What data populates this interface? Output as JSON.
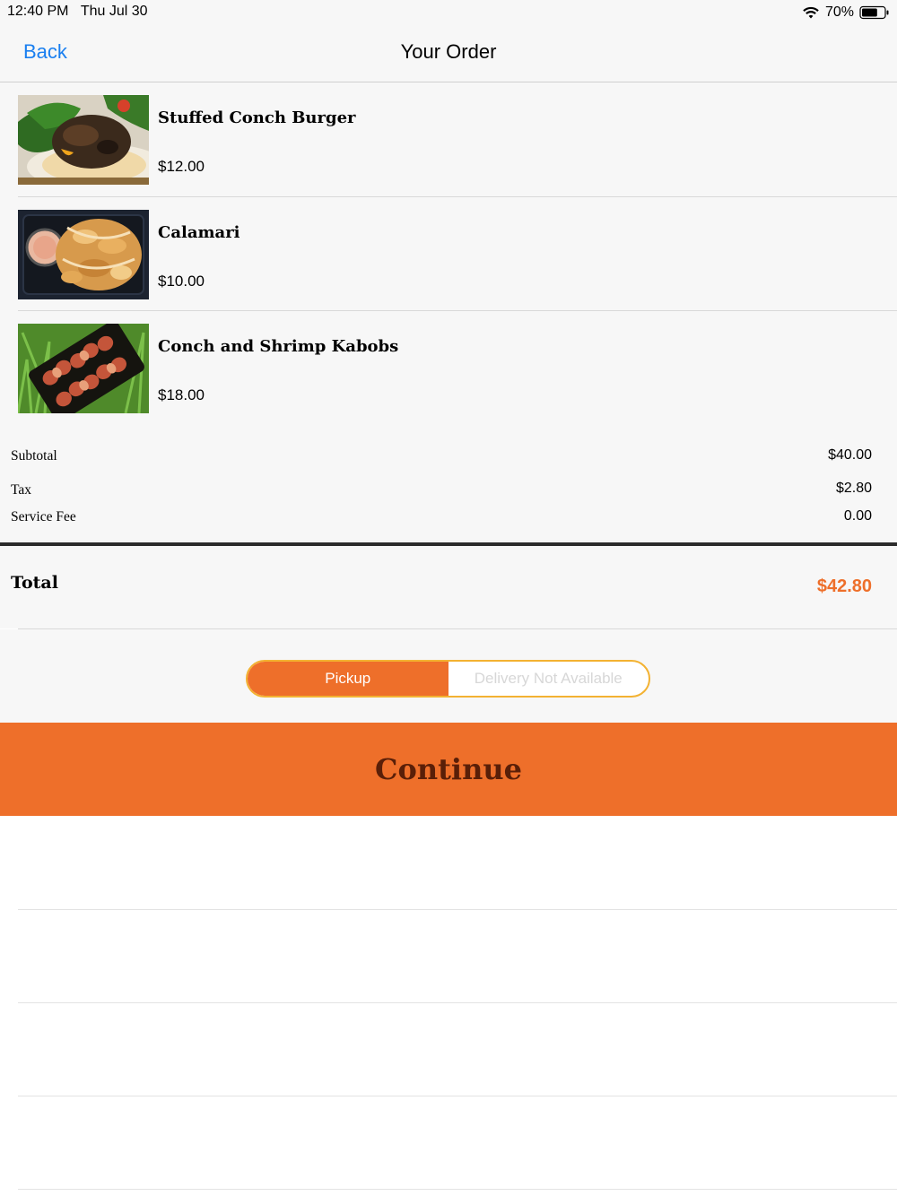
{
  "status_bar": {
    "time": "12:40 PM",
    "date": "Thu Jul 30",
    "battery_percent": "70%",
    "battery_level": 0.7,
    "wifi_icon": "wifi-icon",
    "battery_icon": "battery-icon"
  },
  "nav": {
    "back_label": "Back",
    "title": "Your Order"
  },
  "items": [
    {
      "name": "Stuffed Conch Burger",
      "price": "$12.00",
      "image": "burger-photo"
    },
    {
      "name": "Calamari",
      "price": "$10.00",
      "image": "calamari-photo"
    },
    {
      "name": "Conch and Shrimp Kabobs",
      "price": "$18.00",
      "image": "kabobs-photo"
    }
  ],
  "summary": {
    "subtotal_label": "Subtotal",
    "subtotal_value": "$40.00",
    "tax_label": "Tax",
    "tax_value": "$2.80",
    "service_fee_label": "Service Fee",
    "service_fee_value": "0.00",
    "total_label": "Total",
    "total_value": "$42.80"
  },
  "order_type": {
    "pickup_label": "Pickup",
    "delivery_label": "Delivery Not Available",
    "selected": "Pickup"
  },
  "continue_label": "Continue",
  "colors": {
    "accent": "#ee6f2a",
    "continue_text": "#5a1f08",
    "link": "#1a7ff0",
    "segment_border": "#f3b232"
  }
}
